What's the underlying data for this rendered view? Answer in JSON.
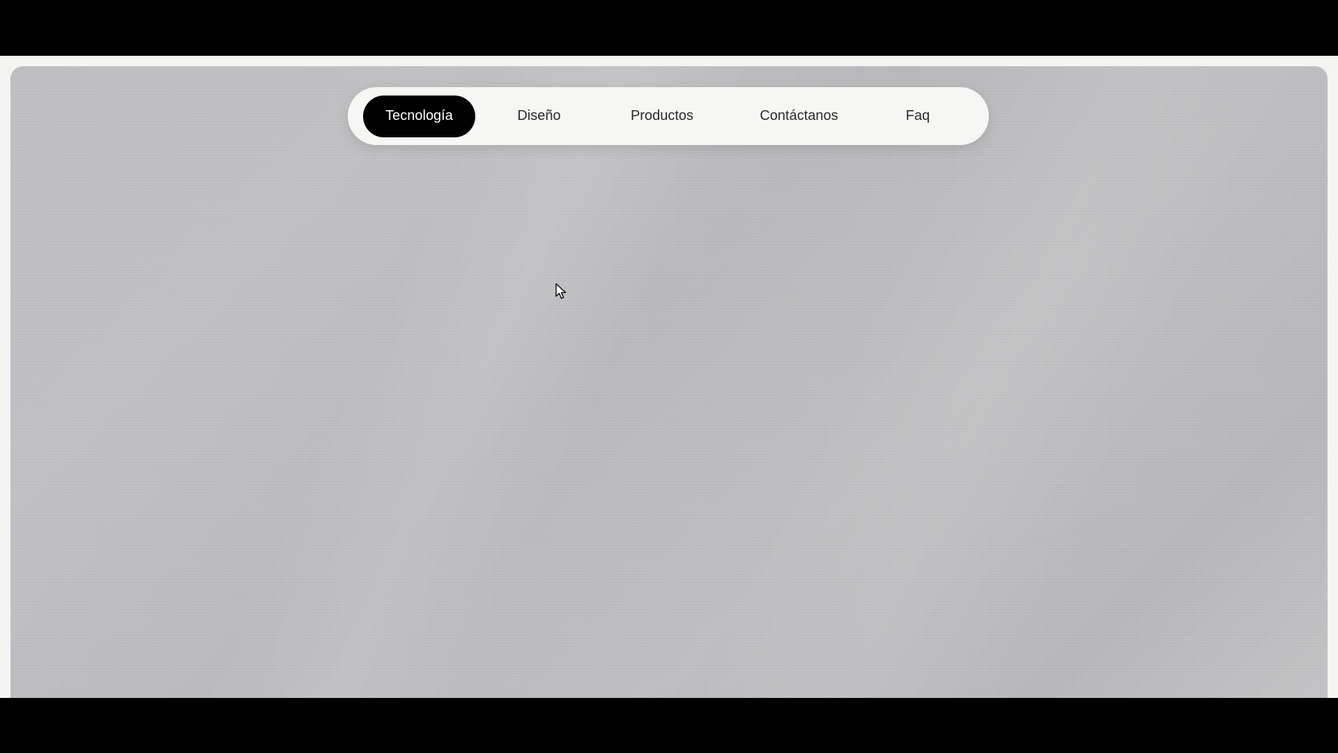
{
  "nav": {
    "items": [
      {
        "label": "Tecnología",
        "active": true
      },
      {
        "label": "Diseño",
        "active": false
      },
      {
        "label": "Productos",
        "active": false
      },
      {
        "label": "Contáctanos",
        "active": false
      },
      {
        "label": "Faq",
        "active": false
      }
    ]
  },
  "colors": {
    "active_pill": "#000000",
    "nav_background": "#f6f6f4",
    "hero_background": "#bcbcbf",
    "letterbox": "#000000"
  },
  "icons": {
    "cursor": "mouse-pointer-icon"
  }
}
